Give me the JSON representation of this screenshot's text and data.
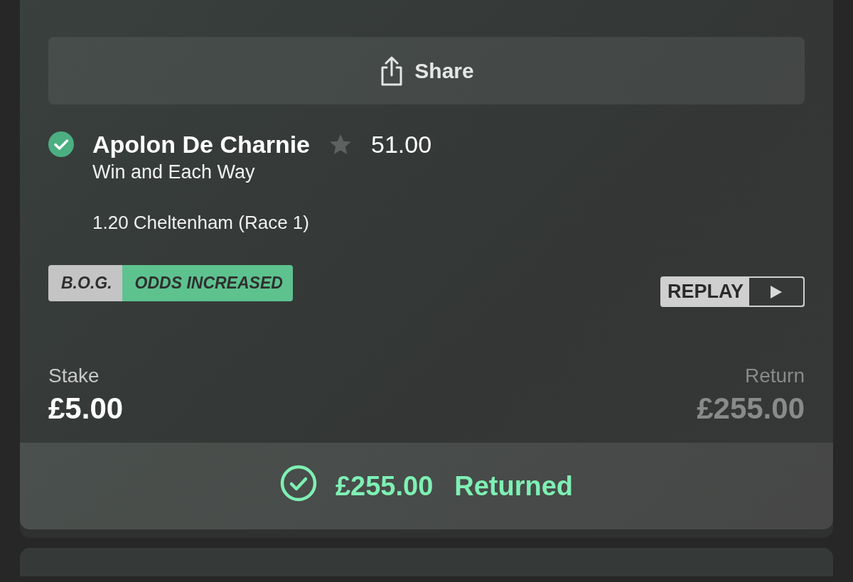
{
  "share_button": {
    "label": "Share"
  },
  "selection": {
    "won": true,
    "name": "Apolon De Charnie",
    "favourite": false,
    "odds": "51.00",
    "market": "Win and Each Way",
    "event": "1.20 Cheltenham (Race 1)"
  },
  "badges": [
    {
      "kind": "bog",
      "label": "B.O.G."
    },
    {
      "kind": "odds",
      "label": "ODDS INCREASED"
    }
  ],
  "replay_button": {
    "label": "REPLAY"
  },
  "stake": {
    "label": "Stake",
    "value": "£5.00"
  },
  "return": {
    "label": "Return",
    "value": "£255.00"
  },
  "outcome": {
    "won": true,
    "amount": "£255.00",
    "label": "Returned"
  }
}
